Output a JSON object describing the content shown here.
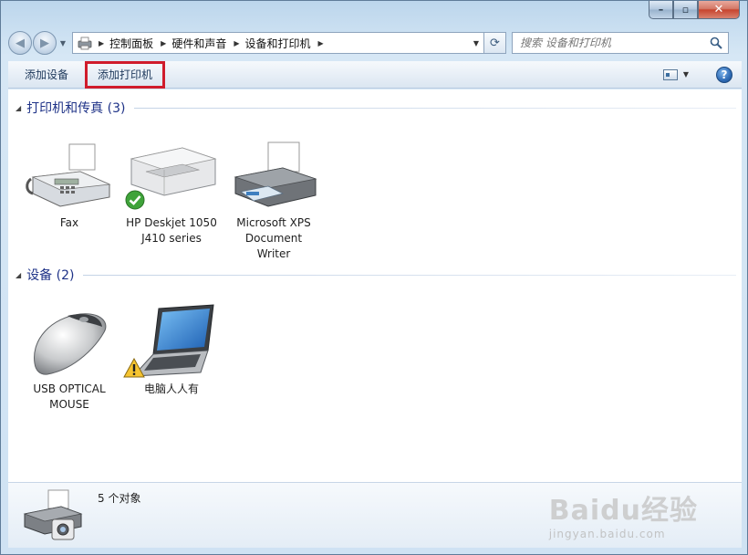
{
  "window": {
    "caption": {
      "minimize": "–",
      "maximize": "▫",
      "close": "✕"
    }
  },
  "nav": {
    "back_glyph": "◀",
    "forward_glyph": "▶",
    "breadcrumbs": [
      "控制面板",
      "硬件和声音",
      "设备和打印机"
    ],
    "refresh_glyph": "⟳"
  },
  "search": {
    "placeholder": "搜索 设备和打印机"
  },
  "toolbar": {
    "add_device": "添加设备",
    "add_printer": "添加打印机",
    "help_glyph": "?"
  },
  "groups": [
    {
      "title": "打印机和传真 (3)",
      "items": [
        {
          "label": "Fax",
          "icon": "fax-icon"
        },
        {
          "label": "HP Deskjet 1050 J410 series",
          "icon": "printer-icon",
          "status": "default-check"
        },
        {
          "label": "Microsoft XPS Document Writer",
          "icon": "xps-printer-icon"
        }
      ]
    },
    {
      "title": "设备 (2)",
      "items": [
        {
          "label": "USB OPTICAL MOUSE",
          "icon": "mouse-icon"
        },
        {
          "label": "电脑人人有",
          "icon": "laptop-icon",
          "status": "warning"
        }
      ]
    }
  ],
  "details": {
    "count_text": "5 个对象"
  },
  "watermark": {
    "logo": "Baidu经验",
    "url": "jingyan.baidu.com"
  },
  "colors": {
    "highlight_box": "#d01c2c",
    "group_title": "#1e3287",
    "toolbar_text": "#1e395b"
  }
}
